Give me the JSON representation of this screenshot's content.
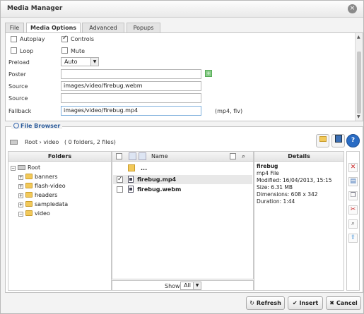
{
  "window": {
    "title": "Media Manager",
    "close_glyph": "×"
  },
  "tabs": [
    "File",
    "Media Options",
    "Advanced",
    "Popups"
  ],
  "media_options": {
    "autoplay_label": "Autoplay",
    "controls_label": "Controls",
    "loop_label": "Loop",
    "mute_label": "Mute",
    "preload_label": "Preload",
    "preload_value": "Auto",
    "poster_label": "Poster",
    "poster_value": "",
    "source_label": "Source",
    "source1_value": "images/video/firebug.webm",
    "source2_value": "",
    "fallback_label": "Fallback",
    "fallback_value": "images/video/firebug.mp4",
    "fallback_hint": "(mp4, flv)",
    "checked": {
      "autoplay": false,
      "controls": true,
      "loop": false,
      "mute": false
    }
  },
  "file_browser": {
    "legend": "File Browser",
    "path": "Root › video",
    "summary": "( 0 folders, 2 files)",
    "folders_header": "Folders",
    "details_header": "Details",
    "name_header": "Name",
    "tree": {
      "root": "Root",
      "folders": [
        "banners",
        "flash-video",
        "headers",
        "sampledata",
        "video"
      ]
    },
    "files": {
      "parent": "...",
      "items": [
        {
          "name": "firebug.mp4",
          "selected": true
        },
        {
          "name": "firebug.webm",
          "selected": false
        }
      ]
    },
    "details": {
      "name": "firebug",
      "type": "mp4 File",
      "modified": "Modified: 16/04/2013, 15:15",
      "size": "Size: 6.31 MB",
      "dimensions": "Dimensions: 608 x 342",
      "duration": "Duration: 1:44"
    },
    "show_label": "Show",
    "show_value": "All"
  },
  "buttons": {
    "refresh": "Refresh",
    "insert": "Insert",
    "cancel": "Cancel"
  },
  "colors": {
    "accent_blue": "#2a5a9a",
    "delete_red": "#cc2222",
    "folder_yellow": "#f2c95a"
  }
}
